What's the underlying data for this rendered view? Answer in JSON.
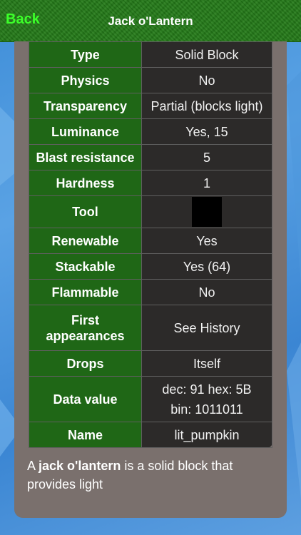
{
  "header": {
    "back_label": "Back",
    "title": "Jack o'Lantern"
  },
  "rows": [
    {
      "key": "Type",
      "value": "Solid Block"
    },
    {
      "key": "Physics",
      "value": "No"
    },
    {
      "key": "Transparency",
      "value": "Partial (blocks light)"
    },
    {
      "key": "Luminance",
      "value": "Yes, 15"
    },
    {
      "key": "Blast resistance",
      "value": "5"
    },
    {
      "key": "Hardness",
      "value": "1"
    },
    {
      "key": "Tool",
      "value": ""
    },
    {
      "key": "Renewable",
      "value": "Yes"
    },
    {
      "key": "Stackable",
      "value": "Yes (64)"
    },
    {
      "key": "Flammable",
      "value": "No"
    },
    {
      "key": "First appearances",
      "value": "See History"
    },
    {
      "key": "Drops",
      "value": "Itself"
    },
    {
      "key": "Data value",
      "value": "dec: 91 hex: 5B bin: 1011011"
    },
    {
      "key": "Name",
      "value": "lit_pumpkin"
    }
  ],
  "description": {
    "prefix": "A ",
    "bold": "jack o'lantern",
    "suffix": " is a solid block that provides light"
  },
  "colors": {
    "header_green": "#237a18",
    "back_green": "#3cff2a",
    "key_green": "#1f6716",
    "value_dark": "#2c2a29",
    "panel": "#7a706d"
  }
}
